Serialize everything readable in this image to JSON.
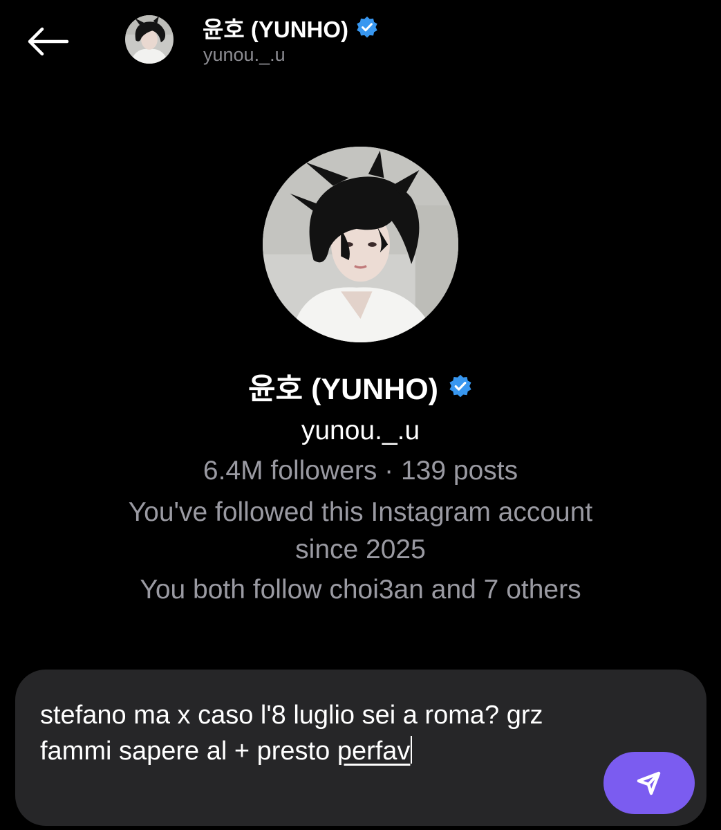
{
  "header": {
    "display_name": "윤호 (YUNHO)",
    "username": "yunou._.u",
    "back_icon": "arrow-left-icon",
    "verified_icon": "verified-badge-icon"
  },
  "profile": {
    "display_name": "윤호 (YUNHO)",
    "username": "yunou._.u",
    "stats": "6.4M followers · 139 posts",
    "since_line1": "You've followed this Instagram account",
    "since_line2": "since 2025",
    "mutual": "You both follow choi3an and 7 others",
    "verified_icon": "verified-badge-icon"
  },
  "composer": {
    "text_main": "stefano ma x caso l'8 luglio sei a roma? grz fammi sapere al + presto ",
    "text_last_word": "perfav",
    "send_icon": "send-icon"
  },
  "colors": {
    "background": "#000000",
    "verified": "#3897f0",
    "composer_bg": "#262628",
    "send_button": "#7b5cf0",
    "muted_text": "#9a9aa2"
  }
}
